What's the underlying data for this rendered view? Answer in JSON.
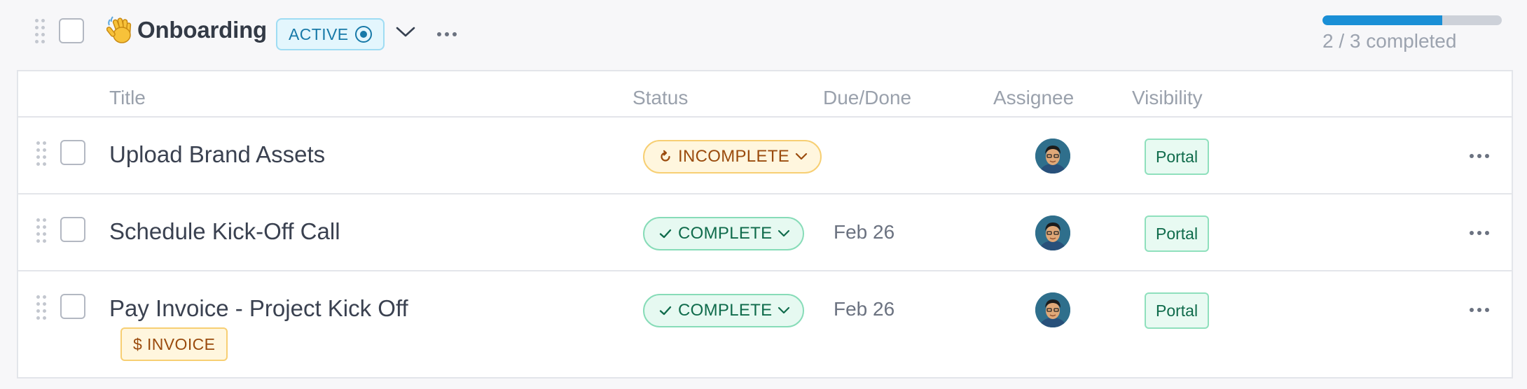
{
  "group": {
    "title": "Onboarding",
    "emoji_icon": "waving-hand-icon",
    "status_label": "ACTIVE",
    "progress_fraction": 0.667,
    "progress_text": "2 / 3 completed"
  },
  "colors": {
    "active_accent": "#1779a8",
    "progress_fill": "#1a8fd6",
    "complete_green": "#0f6b4b",
    "incomplete_amber": "#9a4b0d"
  },
  "table": {
    "columns": {
      "title": "Title",
      "status": "Status",
      "due": "Due/Done",
      "assignee": "Assignee",
      "visibility": "Visibility"
    },
    "rows": [
      {
        "title": "Upload Brand Assets",
        "status": "INCOMPLETE",
        "status_icon": "refresh-icon",
        "due": "",
        "visibility": "Portal",
        "tag": ""
      },
      {
        "title": "Schedule Kick-Off Call",
        "status": "COMPLETE",
        "status_icon": "check-icon",
        "due": "Feb 26",
        "visibility": "Portal",
        "tag": ""
      },
      {
        "title": "Pay Invoice - Project Kick Off",
        "status": "COMPLETE",
        "status_icon": "check-icon",
        "due": "Feb 26",
        "visibility": "Portal",
        "tag": "$ INVOICE"
      }
    ]
  }
}
